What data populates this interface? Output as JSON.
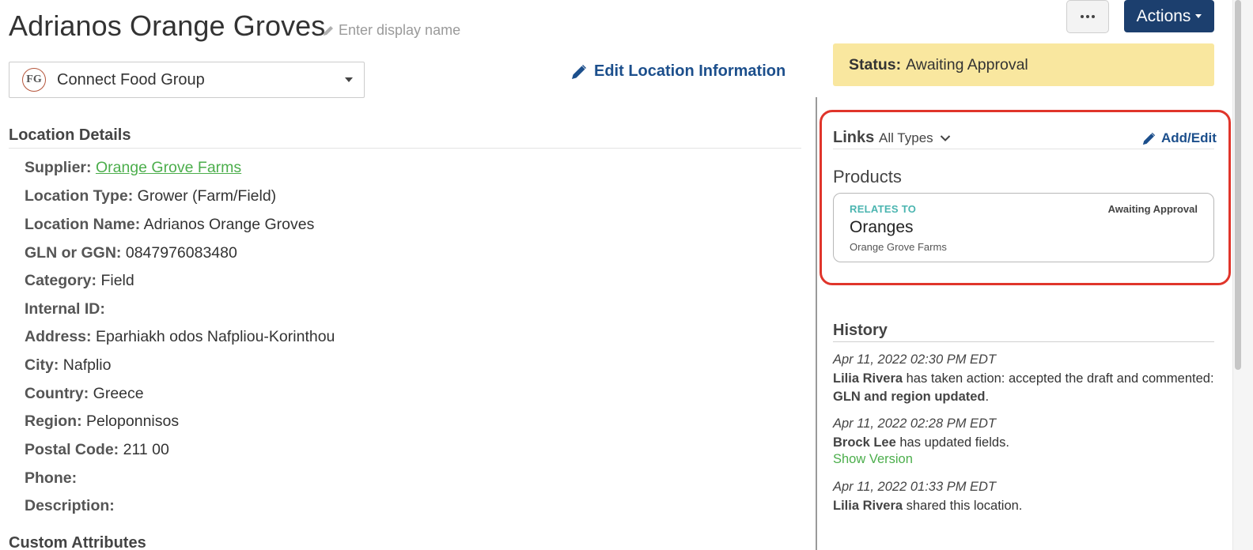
{
  "header": {
    "title": "Adrianos Orange Groves",
    "display_name_placeholder": "Enter display name"
  },
  "org_select": {
    "logo_text": "FG",
    "selected": "Connect Food Group"
  },
  "edit_location_label": "Edit Location Information",
  "location_details": {
    "heading": "Location Details",
    "rows": [
      {
        "label": "Supplier:",
        "value": "Orange Grove Farms",
        "link": true
      },
      {
        "label": "Location Type:",
        "value": "Grower (Farm/Field)"
      },
      {
        "label": "Location Name:",
        "value": "Adrianos Orange Groves"
      },
      {
        "label": "GLN or GGN:",
        "value": "0847976083480"
      },
      {
        "label": "Category:",
        "value": "Field"
      },
      {
        "label": "Internal ID:",
        "value": ""
      },
      {
        "label": "Address:",
        "value": "Eparhiakh odos Nafpliou-Korinthou"
      },
      {
        "label": "City:",
        "value": "Nafplio"
      },
      {
        "label": "Country:",
        "value": "Greece"
      },
      {
        "label": "Region:",
        "value": "Peloponnisos"
      },
      {
        "label": "Postal Code:",
        "value": "211 00"
      },
      {
        "label": "Phone:",
        "value": ""
      },
      {
        "label": "Description:",
        "value": ""
      }
    ]
  },
  "custom_attributes_heading": "Custom Attributes",
  "toolbar": {
    "more_label": "...",
    "actions_label": "Actions"
  },
  "status": {
    "label": "Status:",
    "value": "Awaiting Approval"
  },
  "links": {
    "heading": "Links",
    "filter": "All Types",
    "add_edit_label": "Add/Edit",
    "products_heading": "Products",
    "card": {
      "relates_to": "RELATES TO",
      "status": "Awaiting Approval",
      "title": "Oranges",
      "subtitle": "Orange Grove Farms"
    }
  },
  "history": {
    "heading": "History",
    "entries": [
      {
        "date": "Apr 11, 2022 02:30 PM EDT",
        "user": "Lilia Rivera",
        "text_pre": " has taken action: accepted the draft and commented: ",
        "comment": "GLN and region updated",
        "text_post": "."
      },
      {
        "date": "Apr 11, 2022 02:28 PM EDT",
        "user": "Brock Lee",
        "text_pre": " has updated fields.",
        "link": "Show Version"
      },
      {
        "date": "Apr 11, 2022 01:33 PM EDT",
        "user": "Lilia Rivera",
        "text_pre": " shared this location."
      }
    ]
  },
  "colors": {
    "brand_navy": "#1c3f6e",
    "link_blue": "#1c4f8c",
    "link_green": "#4cae4c",
    "status_yellow": "#f9e79f",
    "highlight_red": "#e0352b",
    "relates_teal": "#4bb5b0"
  },
  "icons": {
    "pencil": "pencil-icon",
    "chevron": "chevron-down-icon",
    "caret": "caret-down-icon",
    "ellipsis": "ellipsis-icon"
  }
}
